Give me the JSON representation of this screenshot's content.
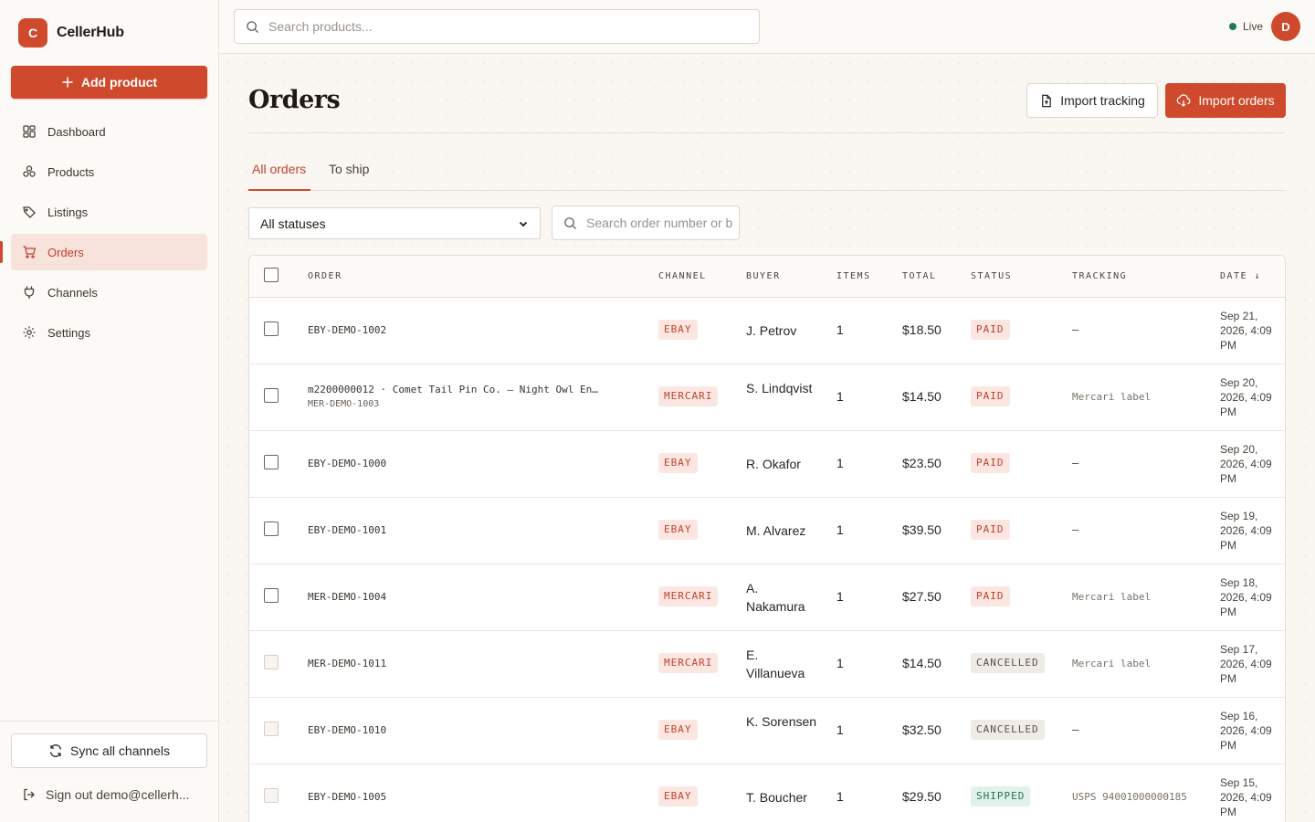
{
  "brand": {
    "logo_letter": "C",
    "name": "CellerHub"
  },
  "sidebar": {
    "add_label": "Add product",
    "items": [
      {
        "label": "Dashboard",
        "icon": "dashboard-icon"
      },
      {
        "label": "Products",
        "icon": "products-icon"
      },
      {
        "label": "Listings",
        "icon": "tag-icon"
      },
      {
        "label": "Orders",
        "icon": "cart-icon",
        "active": true
      },
      {
        "label": "Channels",
        "icon": "plug-icon"
      },
      {
        "label": "Settings",
        "icon": "gear-icon"
      }
    ],
    "sync_label": "Sync all channels",
    "signout_label": "Sign out demo@cellerh..."
  },
  "topbar": {
    "search_placeholder": "Search products...",
    "live_label": "Live",
    "avatar_letter": "D"
  },
  "page": {
    "title": "Orders",
    "import_tracking": "Import tracking",
    "import_orders": "Import orders",
    "tabs": [
      "All orders",
      "To ship"
    ],
    "status_filter": "All statuses",
    "order_search_placeholder": "Search order number or b"
  },
  "table": {
    "headers": {
      "order": "ORDER",
      "channel": "CHANNEL",
      "buyer": "BUYER",
      "items": "ITEMS",
      "total": "TOTAL",
      "status": "STATUS",
      "tracking": "TRACKING",
      "date": "DATE ↓"
    },
    "rows": [
      {
        "order": "EBY-DEMO-1002",
        "sub": "",
        "channel": "EBAY",
        "buyer": "J. Petrov",
        "items": "1",
        "total": "$18.50",
        "status": "PAID",
        "tracking": "–",
        "date": "Sep 21, 2026, 4:09 PM",
        "selectable": true
      },
      {
        "order": "m2200000012 · Comet Tail Pin Co. — Night Owl En…",
        "sub": "MER-DEMO-1003",
        "channel": "MERCARI",
        "buyer": "S. Lindqvist",
        "items": "1",
        "total": "$14.50",
        "status": "PAID",
        "tracking": "Mercari label",
        "date": "Sep 20, 2026, 4:09 PM",
        "selectable": true
      },
      {
        "order": "EBY-DEMO-1000",
        "sub": "",
        "channel": "EBAY",
        "buyer": "R. Okafor",
        "items": "1",
        "total": "$23.50",
        "status": "PAID",
        "tracking": "–",
        "date": "Sep 20, 2026, 4:09 PM",
        "selectable": true
      },
      {
        "order": "EBY-DEMO-1001",
        "sub": "",
        "channel": "EBAY",
        "buyer": "M. Alvarez",
        "items": "1",
        "total": "$39.50",
        "status": "PAID",
        "tracking": "–",
        "date": "Sep 19, 2026, 4:09 PM",
        "selectable": true
      },
      {
        "order": "MER-DEMO-1004",
        "sub": "",
        "channel": "MERCARI",
        "buyer": "A. Nakamura",
        "items": "1",
        "total": "$27.50",
        "status": "PAID",
        "tracking": "Mercari label",
        "date": "Sep 18, 2026, 4:09 PM",
        "selectable": true
      },
      {
        "order": "MER-DEMO-1011",
        "sub": "",
        "channel": "MERCARI",
        "buyer": "E. Villanueva",
        "items": "1",
        "total": "$14.50",
        "status": "CANCELLED",
        "tracking": "Mercari label",
        "date": "Sep 17, 2026, 4:09 PM",
        "selectable": false
      },
      {
        "order": "EBY-DEMO-1010",
        "sub": "",
        "channel": "EBAY",
        "buyer": "K. Sorensen",
        "items": "1",
        "total": "$32.50",
        "status": "CANCELLED",
        "tracking": "–",
        "date": "Sep 16, 2026, 4:09 PM",
        "selectable": false
      },
      {
        "order": "EBY-DEMO-1005",
        "sub": "",
        "channel": "EBAY",
        "buyer": "T. Boucher",
        "items": "1",
        "total": "$29.50",
        "status": "SHIPPED",
        "tracking": "USPS 94001000000185",
        "date": "Sep 15, 2026, 4:09 PM",
        "selectable": false
      }
    ]
  },
  "colors": {
    "accent": "#cf4a2c",
    "live": "#1f7a55"
  }
}
